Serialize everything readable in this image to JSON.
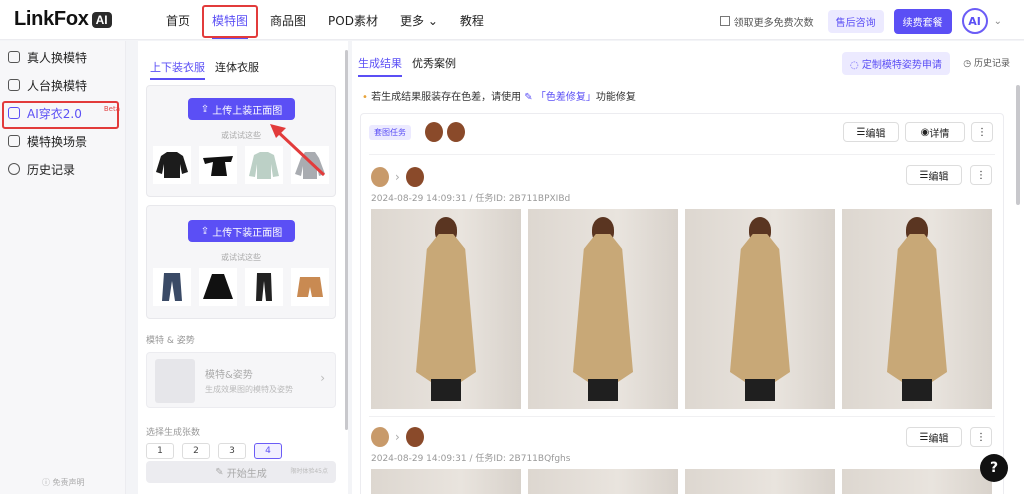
{
  "header": {
    "logo_text": "LinkFox",
    "logo_badge": "AI",
    "nav": [
      "首页",
      "模特图",
      "商品图",
      "POD素材",
      "更多",
      "教程"
    ],
    "free_times": "领取更多免费次数",
    "after_sales": "售后咨询",
    "renew": "续费套餐",
    "avatar": "AI"
  },
  "sidebar": {
    "items": [
      "真人换模特",
      "人台换模特",
      "AI穿衣2.0",
      "模特换场景",
      "历史记录"
    ],
    "beta": "Beta",
    "disclaimer": "免责声明"
  },
  "config": {
    "tabs": [
      "上下装衣服",
      "连体衣服"
    ],
    "upload_top": "上传上装正面图",
    "upload_bottom": "上传下装正面图",
    "or_try": "或试试这些",
    "model_section": "模特 & 姿势",
    "model_title": "模特&姿势",
    "model_sub": "生成效果图的模特及姿势",
    "count_section": "选择生成张数",
    "counts": [
      "1",
      "2",
      "3",
      "4"
    ],
    "generate": "开始生成",
    "generate_hint": "限时体验45点"
  },
  "results": {
    "tabs": [
      "生成结果",
      "优秀案例"
    ],
    "custom_pose": "定制模特姿势申请",
    "history": "历史记录",
    "tip_prefix": "若生成结果服装存在色差，请使用",
    "tip_link": "「色差修复」",
    "tip_suffix": "功能修复",
    "task_tag": "套图任务",
    "edit": "编辑",
    "details": "详情",
    "meta1": "2024-08-29 14:09:31 / 任务ID: 2B711BPXIBd",
    "meta2": "2024-08-29 14:09:31 / 任务ID: 2B711BQfghs"
  },
  "help": "?",
  "colors": {
    "accent": "#5b4ff5",
    "highlight": "#e23b3b"
  }
}
